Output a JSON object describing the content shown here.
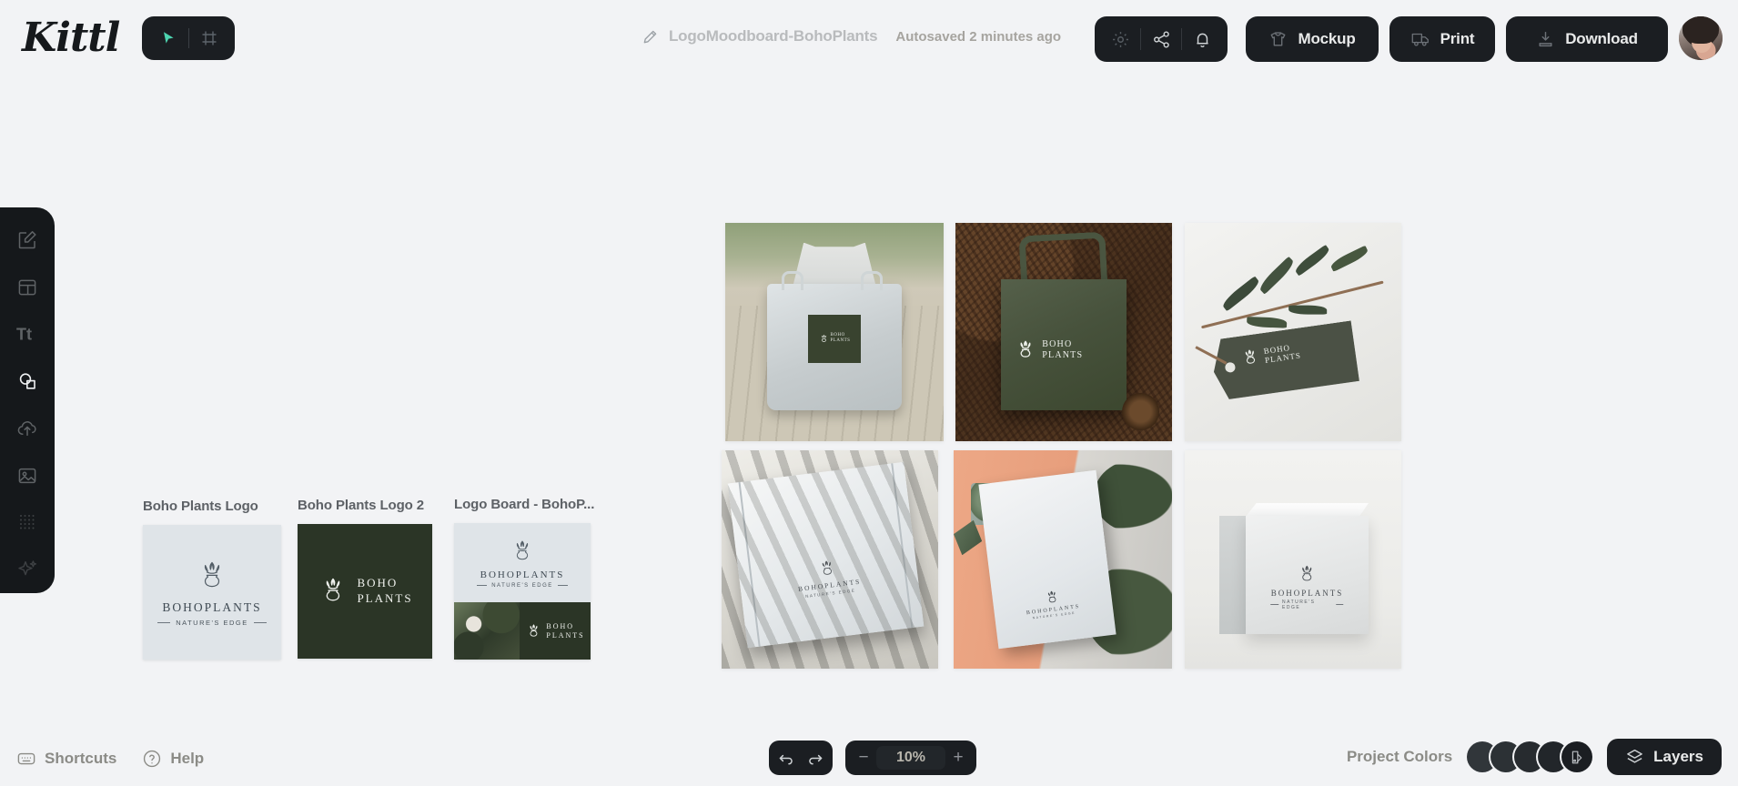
{
  "app": {
    "brand": "Kittl",
    "background": "#f2f3f5",
    "panel_dark": "#1b1e22",
    "accent_teal": "#4dd4b0"
  },
  "topbar": {
    "mode": {
      "select_icon": "cursor-play-icon",
      "frame_icon": "artboard-frame-icon"
    },
    "document": {
      "edit_icon": "pencil-icon",
      "title": "LogoMoodboard-BohoPlants",
      "autosave_status": "Autosaved 2 minutes ago"
    },
    "icon_group": [
      {
        "name": "settings-icon",
        "label": "Settings"
      },
      {
        "name": "share-icon",
        "label": "Share"
      },
      {
        "name": "notifications-bell-icon",
        "label": "Notifications"
      }
    ],
    "actions": [
      {
        "name": "mockup-button",
        "label": "Mockup",
        "icon": "tshirt-icon"
      },
      {
        "name": "print-button",
        "label": "Print",
        "icon": "delivery-truck-icon"
      },
      {
        "name": "download-button",
        "label": "Download",
        "icon": "download-tray-icon"
      }
    ],
    "avatar": {
      "name": "user-avatar",
      "alt": "User profile"
    }
  },
  "sidebar": {
    "items": [
      {
        "name": "sidebar-item-design",
        "icon": "pencil-square-icon",
        "label": "Design",
        "active": false
      },
      {
        "name": "sidebar-item-templates",
        "icon": "layout-template-icon",
        "label": "Templates",
        "active": false
      },
      {
        "name": "sidebar-item-text",
        "icon": "text-tt-icon",
        "label": "Text",
        "active": false
      },
      {
        "name": "sidebar-item-elements",
        "icon": "shapes-icon",
        "label": "Elements",
        "active": true
      },
      {
        "name": "sidebar-item-uploads",
        "icon": "cloud-upload-icon",
        "label": "Uploads",
        "active": false
      },
      {
        "name": "sidebar-item-photos",
        "icon": "image-icon",
        "label": "Photos",
        "active": false
      },
      {
        "name": "sidebar-item-patterns",
        "icon": "dot-grid-icon",
        "label": "Patterns",
        "active": false
      },
      {
        "name": "sidebar-item-ai",
        "icon": "sparkle-ai-icon",
        "label": "AI Tools",
        "active": false
      }
    ]
  },
  "canvas": {
    "artboards": [
      {
        "name": "artboard-boho-plants-logo",
        "label": "Boho Plants Logo",
        "type": "logo-light",
        "background": "#dfe4e8",
        "logo": {
          "wordmark": "BOHOPLANTS",
          "tagline": "NATURE'S EDGE",
          "ink": "#404a52"
        }
      },
      {
        "name": "artboard-boho-plants-logo-2",
        "label": "Boho Plants Logo 2",
        "type": "logo-dark",
        "background": "#2b3526",
        "logo": {
          "line1": "BOHO",
          "line2": "PLANTS",
          "ink": "#f0f2ee"
        }
      },
      {
        "name": "artboard-logo-board",
        "label": "Logo Board - BohoP...",
        "type": "board",
        "background": "#dfe4e8",
        "logo": {
          "wordmark": "BOHOPLANTS",
          "tagline": "NATURE'S EDGE",
          "ink": "#404a52"
        },
        "panel": {
          "line1": "BOHO",
          "line2": "PLANTS",
          "background": "#2b3526",
          "ink": "#f0f2ee"
        }
      }
    ],
    "mockups": [
      {
        "name": "mockup-tote-bag-boardwalk",
        "alt": "Light canvas tote bag on wooden boardwalk",
        "patch_color": "#39432f",
        "label": {
          "line1": "BOHO",
          "line2": "PLANTS"
        }
      },
      {
        "name": "mockup-tote-bag-pine",
        "alt": "Dark green tote bag on pine needles",
        "patch_color": "#49543f",
        "label": {
          "line1": "BOHO",
          "line2": "PLANTS"
        }
      },
      {
        "name": "mockup-hang-tag-eucalyptus",
        "alt": "Dark hang tag with eucalyptus branch",
        "patch_color": "#494f44",
        "label": {
          "line1": "BOHO",
          "line2": "PLANTS"
        }
      },
      {
        "name": "mockup-mailer-box-shadows",
        "alt": "White mailer box with palm leaf shadows",
        "label": {
          "line1": "BOHOPLANTS",
          "line2": "NATURE'S EDGE"
        }
      },
      {
        "name": "mockup-letterhead-terracotta",
        "alt": "Letterhead on terracotta and concrete with plants",
        "label": {
          "line1": "BOHOPLANTS",
          "line2": "NATURE'S EDGE"
        }
      },
      {
        "name": "mockup-cube-box",
        "alt": "White cube product box",
        "label": {
          "line1": "BOHOPLANTS",
          "line2": "NATURE'S EDGE"
        }
      }
    ]
  },
  "bottombar": {
    "left": [
      {
        "name": "shortcuts-button",
        "label": "Shortcuts",
        "icon": "keyboard-icon"
      },
      {
        "name": "help-button",
        "label": "Help",
        "icon": "question-circle-icon"
      }
    ],
    "history": {
      "undo_icon": "undo-arrow-icon",
      "redo_icon": "redo-arrow-icon"
    },
    "zoom": {
      "minus": "−",
      "value": "10%",
      "plus": "+"
    },
    "project_colors": {
      "label": "Project Colors",
      "swatches": [
        "#31363a",
        "#2c3135",
        "#272b2f",
        "#22262a"
      ],
      "palette_icon": "color-palette-icon"
    },
    "layers": {
      "label": "Layers",
      "icon": "layers-stack-icon"
    }
  }
}
